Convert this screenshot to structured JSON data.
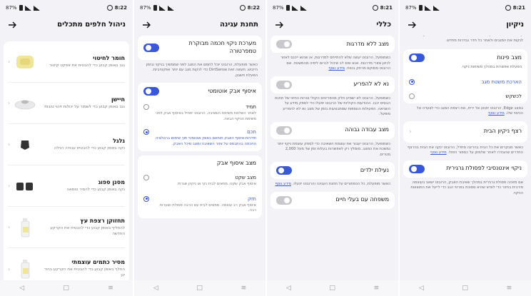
{
  "status": {
    "s1": {
      "time": "8:22",
      "battery": "87%"
    },
    "s2": {
      "time": "8:22",
      "battery": "87%"
    },
    "s3": {
      "time": "8:21",
      "battery": "87%"
    },
    "s4": {
      "time": "8:21",
      "battery": "87%"
    }
  },
  "nav": {
    "back": "◁",
    "home": "□",
    "recent": "≡"
  },
  "screen1": {
    "title": "ניהול חלפים מתכלים",
    "parts": [
      {
        "name": "חומר לחיטוי",
        "desc": "נגב באופן קבוע כדי להבטיח את אפקט קיטור"
      },
      {
        "name": "חיישן",
        "desc": "נגב באופן קבוע כדי לשמור על יכולות זיהוי טובות"
      },
      {
        "name": "גלגל",
        "desc": "נקה באופן קבוע כדי להבטיח עבודה רגילה"
      },
      {
        "name": "מסנן ספוג",
        "desc": "נקה באופן קבוע כדי להסיר טומאה"
      },
      {
        "name": "תחזוקן רצפת עץ",
        "desc": "להחליף באופן קבוע כדי להבטיח את הקרקע החדשה"
      },
      {
        "name": "מסיר כתמים עוצמתי",
        "desc": "החלף באופן קבוע כדי להבטיח את הקרקע בהיר יכן"
      }
    ]
  },
  "screen2": {
    "title": "תחנת עגינה",
    "smart_label": "מערכת ניקוי חכמה מבוקרת טמפרטורה",
    "smart_desc": "כאשר מופעלת, הרובוט יוכל לחמם את המגב לפני שממשיך בניקוי ובזמן הייבוש. תעשה זאת DirtSense כדי לנקות מגב עם יותר אפקטיביות. הפעלת חשבון.",
    "auto_label": "איסוף אבק אוטומטי",
    "opt_always": "תמיד",
    "opt_always_desc": "לאחר השלמת משימת השאיבה, הרובוט יתחיל באיסוף אבק לפני משימת הניקוי הבאה.",
    "opt_smart": "חכם",
    "opt_smart_desc": "תדירות איסוף האבק תותאם באופן אוטומטי תוך שימוש ברגולציה החכמה בהתבסס על אזור השאיבה ומצב מיכל האבק.",
    "dust_title": "מצב איסוף אבק",
    "opt_quiet": "מצב שקט",
    "opt_quiet_desc": "איסוף אבק שקט. מתאים לבית נקי או ניקיון שגרתי.",
    "opt_strong": "חזק",
    "opt_strong_desc": "איסוף אבק רב עוצמה. מתאים לבית עם הרבה פסולת ושערות רבה."
  },
  "screen3": {
    "title": "כללי",
    "stairs_label": "מצב ללא מדרגות",
    "stairs_desc": "כשמופעל, הרובוט יעשה שלא להתייחס למדרגות, או שהוא ייכנס לאזור לכיוון אזורי מדרגות. אנא שים לב שיכול לגרום ליפיה מהמשטח. אם הרובוט ממוקם מרחק בטוח.",
    "stairs_link": "מידע נוסף",
    "carpet_label": "נא לא להפריע",
    "carpet_desc": "כשמופעל, הרובוט לא ישמיע חלק מהפריטים הקולי ונורות החיווי של תחנת הבסיס יכבו. ההודעות הקוליות של הרובוט יפעלו כדי לספק מידע על השגיאה. הפעולות הנוספות שמתבצעות בזמן של מצב נא לא להפריע מופעל.",
    "high_label": "מצב עבודה גבוהה",
    "high_desc": "כשמופעל, הרובוט יעבור את עוצמת השאיבה כדי לספק עוצמת ניקוי יותר נמשכת את המצב. מומלץ רק לאפשרות בעלות זמן של מעל 2,000 מטרים.",
    "child_label": "נעילת ילדים",
    "child_desc": "כאשר מופעלת, כל הכפתורים על תחנת העגינה והרובוט יינעלו.",
    "child_link": "מידע נוסף",
    "pets_label": "משפחה עם בעלי חיים"
  },
  "screen4": {
    "title": "ניקיון",
    "top_desc": "קודמים. במשימות ניקוי במצב Free, הרובוט יחזור לבסיס המטען כדי לנקות את המגבים ולאחר כל חדר נבדרות מחדש.",
    "corner_label": "מצב פינות",
    "corner_desc": "הפעלת אפשרות במהלך משימות ניקוי.",
    "opt_ext": "הארכת משטח מגב",
    "opt_edge": "לכשקש",
    "opt_edge_desc": "במצב Edge, הרובוט יתנוע אל יריח, את רצפת המגב כדי לצעדה אל הכיסוי שלו.",
    "opt_edge_link": "מידע נוסף",
    "floor_label": "רצף ניקיון הבית",
    "floor_desc": "כאשר מבקרים את כל הבית בהריגה מחדל, הרובוט ינקה את הבית בהרצף החדרים שהוגדרו לאחר שלמתן על כמפור הזחל.",
    "floor_link": "מידע נוסף",
    "smart_label": "ניקוי אינטנסיבי לפסולת גרגירית",
    "smart_desc": "אם מזוהה פסולת גרגירית במהלך שאיבת האבק, הרובוט ישאב בעוצמה מירבית בחזור כדי לוודא שהיא סמוכת בפרטי הגב כדי לייעל את התוצאות הניקוי."
  },
  "colors": {
    "accent": "#3a57d8",
    "toggle_off": "#c8c8cc",
    "bg": "#f3f3f7",
    "card": "#ffffff"
  }
}
